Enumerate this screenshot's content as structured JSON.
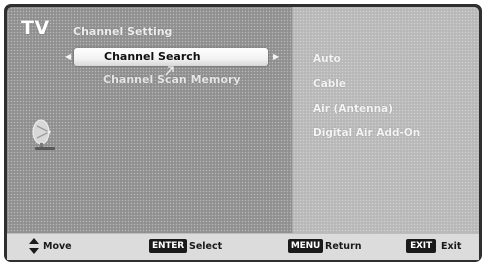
{
  "header": {
    "tv_label": "TV",
    "menu_title": "Channel Setting"
  },
  "menu": {
    "items": [
      {
        "label": "Channel Search",
        "selected": true
      },
      {
        "label": "Channel Scan Memory",
        "selected": false
      }
    ],
    "left_arrow": "◀",
    "right_arrow": "▶"
  },
  "options": [
    {
      "label": "Auto"
    },
    {
      "label": "Cable"
    },
    {
      "label": "Air (Antenna)"
    },
    {
      "label": "Digital Air Add-On"
    }
  ],
  "icons": {
    "category_icon": "satellite-dish-icon",
    "move_icon": "up-down-arrows-icon"
  },
  "footer": {
    "move_label": "Move",
    "enter_key": "ENTER",
    "select_label": "Select",
    "menu_key": "MENU",
    "return_label": "Return",
    "exit_key": "EXIT",
    "exit_label": "Exit"
  },
  "colors": {
    "panel": "#8f8f8f",
    "right_panel": "#b8b8b8",
    "highlight": "#ffffff",
    "footer": "#dcdcdc",
    "key_bg": "#1a1a1a"
  }
}
